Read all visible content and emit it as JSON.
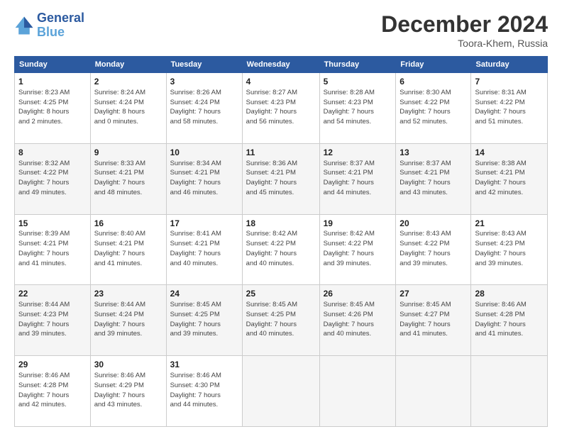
{
  "header": {
    "logo_line1": "General",
    "logo_line2": "Blue",
    "title": "December 2024",
    "subtitle": "Toora-Khem, Russia"
  },
  "days_of_week": [
    "Sunday",
    "Monday",
    "Tuesday",
    "Wednesday",
    "Thursday",
    "Friday",
    "Saturday"
  ],
  "weeks": [
    [
      {
        "day": "1",
        "info": "Sunrise: 8:23 AM\nSunset: 4:25 PM\nDaylight: 8 hours\nand 2 minutes."
      },
      {
        "day": "2",
        "info": "Sunrise: 8:24 AM\nSunset: 4:24 PM\nDaylight: 8 hours\nand 0 minutes."
      },
      {
        "day": "3",
        "info": "Sunrise: 8:26 AM\nSunset: 4:24 PM\nDaylight: 7 hours\nand 58 minutes."
      },
      {
        "day": "4",
        "info": "Sunrise: 8:27 AM\nSunset: 4:23 PM\nDaylight: 7 hours\nand 56 minutes."
      },
      {
        "day": "5",
        "info": "Sunrise: 8:28 AM\nSunset: 4:23 PM\nDaylight: 7 hours\nand 54 minutes."
      },
      {
        "day": "6",
        "info": "Sunrise: 8:30 AM\nSunset: 4:22 PM\nDaylight: 7 hours\nand 52 minutes."
      },
      {
        "day": "7",
        "info": "Sunrise: 8:31 AM\nSunset: 4:22 PM\nDaylight: 7 hours\nand 51 minutes."
      }
    ],
    [
      {
        "day": "8",
        "info": "Sunrise: 8:32 AM\nSunset: 4:22 PM\nDaylight: 7 hours\nand 49 minutes."
      },
      {
        "day": "9",
        "info": "Sunrise: 8:33 AM\nSunset: 4:21 PM\nDaylight: 7 hours\nand 48 minutes."
      },
      {
        "day": "10",
        "info": "Sunrise: 8:34 AM\nSunset: 4:21 PM\nDaylight: 7 hours\nand 46 minutes."
      },
      {
        "day": "11",
        "info": "Sunrise: 8:36 AM\nSunset: 4:21 PM\nDaylight: 7 hours\nand 45 minutes."
      },
      {
        "day": "12",
        "info": "Sunrise: 8:37 AM\nSunset: 4:21 PM\nDaylight: 7 hours\nand 44 minutes."
      },
      {
        "day": "13",
        "info": "Sunrise: 8:37 AM\nSunset: 4:21 PM\nDaylight: 7 hours\nand 43 minutes."
      },
      {
        "day": "14",
        "info": "Sunrise: 8:38 AM\nSunset: 4:21 PM\nDaylight: 7 hours\nand 42 minutes."
      }
    ],
    [
      {
        "day": "15",
        "info": "Sunrise: 8:39 AM\nSunset: 4:21 PM\nDaylight: 7 hours\nand 41 minutes."
      },
      {
        "day": "16",
        "info": "Sunrise: 8:40 AM\nSunset: 4:21 PM\nDaylight: 7 hours\nand 41 minutes."
      },
      {
        "day": "17",
        "info": "Sunrise: 8:41 AM\nSunset: 4:21 PM\nDaylight: 7 hours\nand 40 minutes."
      },
      {
        "day": "18",
        "info": "Sunrise: 8:42 AM\nSunset: 4:22 PM\nDaylight: 7 hours\nand 40 minutes."
      },
      {
        "day": "19",
        "info": "Sunrise: 8:42 AM\nSunset: 4:22 PM\nDaylight: 7 hours\nand 39 minutes."
      },
      {
        "day": "20",
        "info": "Sunrise: 8:43 AM\nSunset: 4:22 PM\nDaylight: 7 hours\nand 39 minutes."
      },
      {
        "day": "21",
        "info": "Sunrise: 8:43 AM\nSunset: 4:23 PM\nDaylight: 7 hours\nand 39 minutes."
      }
    ],
    [
      {
        "day": "22",
        "info": "Sunrise: 8:44 AM\nSunset: 4:23 PM\nDaylight: 7 hours\nand 39 minutes."
      },
      {
        "day": "23",
        "info": "Sunrise: 8:44 AM\nSunset: 4:24 PM\nDaylight: 7 hours\nand 39 minutes."
      },
      {
        "day": "24",
        "info": "Sunrise: 8:45 AM\nSunset: 4:25 PM\nDaylight: 7 hours\nand 39 minutes."
      },
      {
        "day": "25",
        "info": "Sunrise: 8:45 AM\nSunset: 4:25 PM\nDaylight: 7 hours\nand 40 minutes."
      },
      {
        "day": "26",
        "info": "Sunrise: 8:45 AM\nSunset: 4:26 PM\nDaylight: 7 hours\nand 40 minutes."
      },
      {
        "day": "27",
        "info": "Sunrise: 8:45 AM\nSunset: 4:27 PM\nDaylight: 7 hours\nand 41 minutes."
      },
      {
        "day": "28",
        "info": "Sunrise: 8:46 AM\nSunset: 4:28 PM\nDaylight: 7 hours\nand 41 minutes."
      }
    ],
    [
      {
        "day": "29",
        "info": "Sunrise: 8:46 AM\nSunset: 4:28 PM\nDaylight: 7 hours\nand 42 minutes."
      },
      {
        "day": "30",
        "info": "Sunrise: 8:46 AM\nSunset: 4:29 PM\nDaylight: 7 hours\nand 43 minutes."
      },
      {
        "day": "31",
        "info": "Sunrise: 8:46 AM\nSunset: 4:30 PM\nDaylight: 7 hours\nand 44 minutes."
      },
      {
        "day": "",
        "info": ""
      },
      {
        "day": "",
        "info": ""
      },
      {
        "day": "",
        "info": ""
      },
      {
        "day": "",
        "info": ""
      }
    ]
  ]
}
